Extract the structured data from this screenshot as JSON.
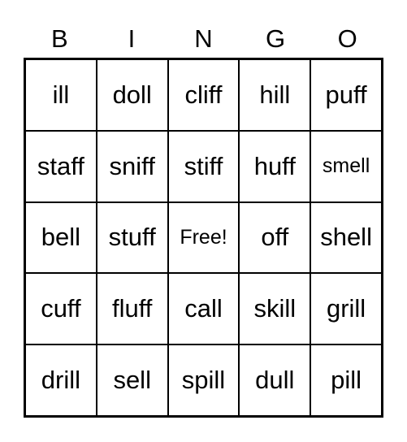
{
  "header": [
    "B",
    "I",
    "N",
    "G",
    "O"
  ],
  "cells": [
    [
      "ill",
      "doll",
      "cliff",
      "hill",
      "puff"
    ],
    [
      "staff",
      "sniff",
      "stiff",
      "huff",
      "smell"
    ],
    [
      "bell",
      "stuff",
      "Free!",
      "off",
      "shell"
    ],
    [
      "cuff",
      "fluff",
      "call",
      "skill",
      "grill"
    ],
    [
      "drill",
      "sell",
      "spill",
      "dull",
      "pill"
    ]
  ]
}
